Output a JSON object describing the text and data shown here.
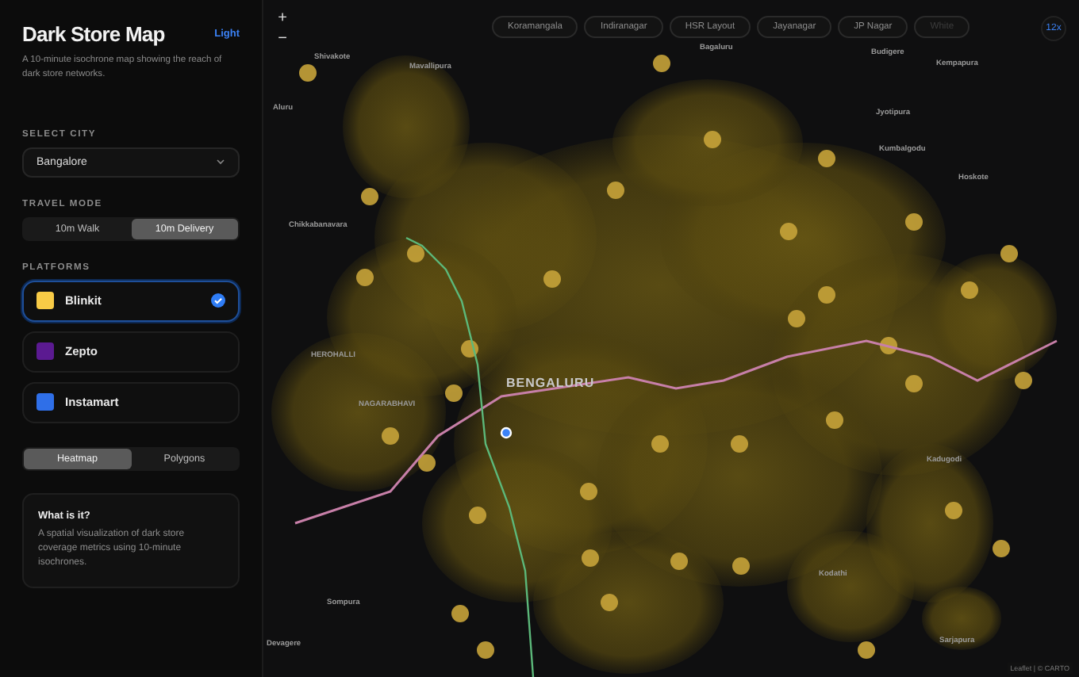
{
  "sidebar": {
    "title": "Dark Store Map",
    "theme_toggle": "Light",
    "description": "A 10-minute isochrone map showing the reach of dark store networks.",
    "city": {
      "label": "SELECT CITY",
      "value": "Bangalore"
    },
    "travel_mode": {
      "label": "TRAVEL MODE",
      "options": [
        {
          "label": "10m Walk",
          "selected": false
        },
        {
          "label": "10m Delivery",
          "selected": true
        }
      ]
    },
    "platforms": {
      "label": "PLATFORMS",
      "items": [
        {
          "name": "Blinkit",
          "selected": true,
          "color": "#f8cb46"
        },
        {
          "name": "Zepto",
          "selected": false,
          "color": "#5b1a91"
        },
        {
          "name": "Instamart",
          "selected": false,
          "color": "#2f6fe8"
        }
      ]
    },
    "view": [
      {
        "label": "Heatmap",
        "selected": true
      },
      {
        "label": "Polygons",
        "selected": false
      }
    ],
    "info": {
      "title": "What is it?",
      "text": "A spatial visualization of dark store coverage metrics using 10-minute isochrones."
    }
  },
  "map": {
    "zoom_in": "+",
    "zoom_out": "−",
    "zoom_level": "12x",
    "areas": [
      "Koramangala",
      "Indiranagar",
      "HSR Layout",
      "Jayanagar",
      "JP Nagar",
      "White"
    ],
    "places": [
      "Shivakote",
      "Mavallipura",
      "Bagaluru",
      "Budigere",
      "Kempapura",
      "Jyotipura",
      "Hoskote",
      "Kumbalgodu",
      "Aluru",
      "Chikkabanavara",
      "HEROHALLI",
      "BENGALURU",
      "NAGARABHAVI",
      "Kadugodi",
      "Sompura",
      "Devagere",
      "Sarjapura",
      "Kodathi"
    ],
    "attribution": "Leaflet | © CARTO"
  }
}
